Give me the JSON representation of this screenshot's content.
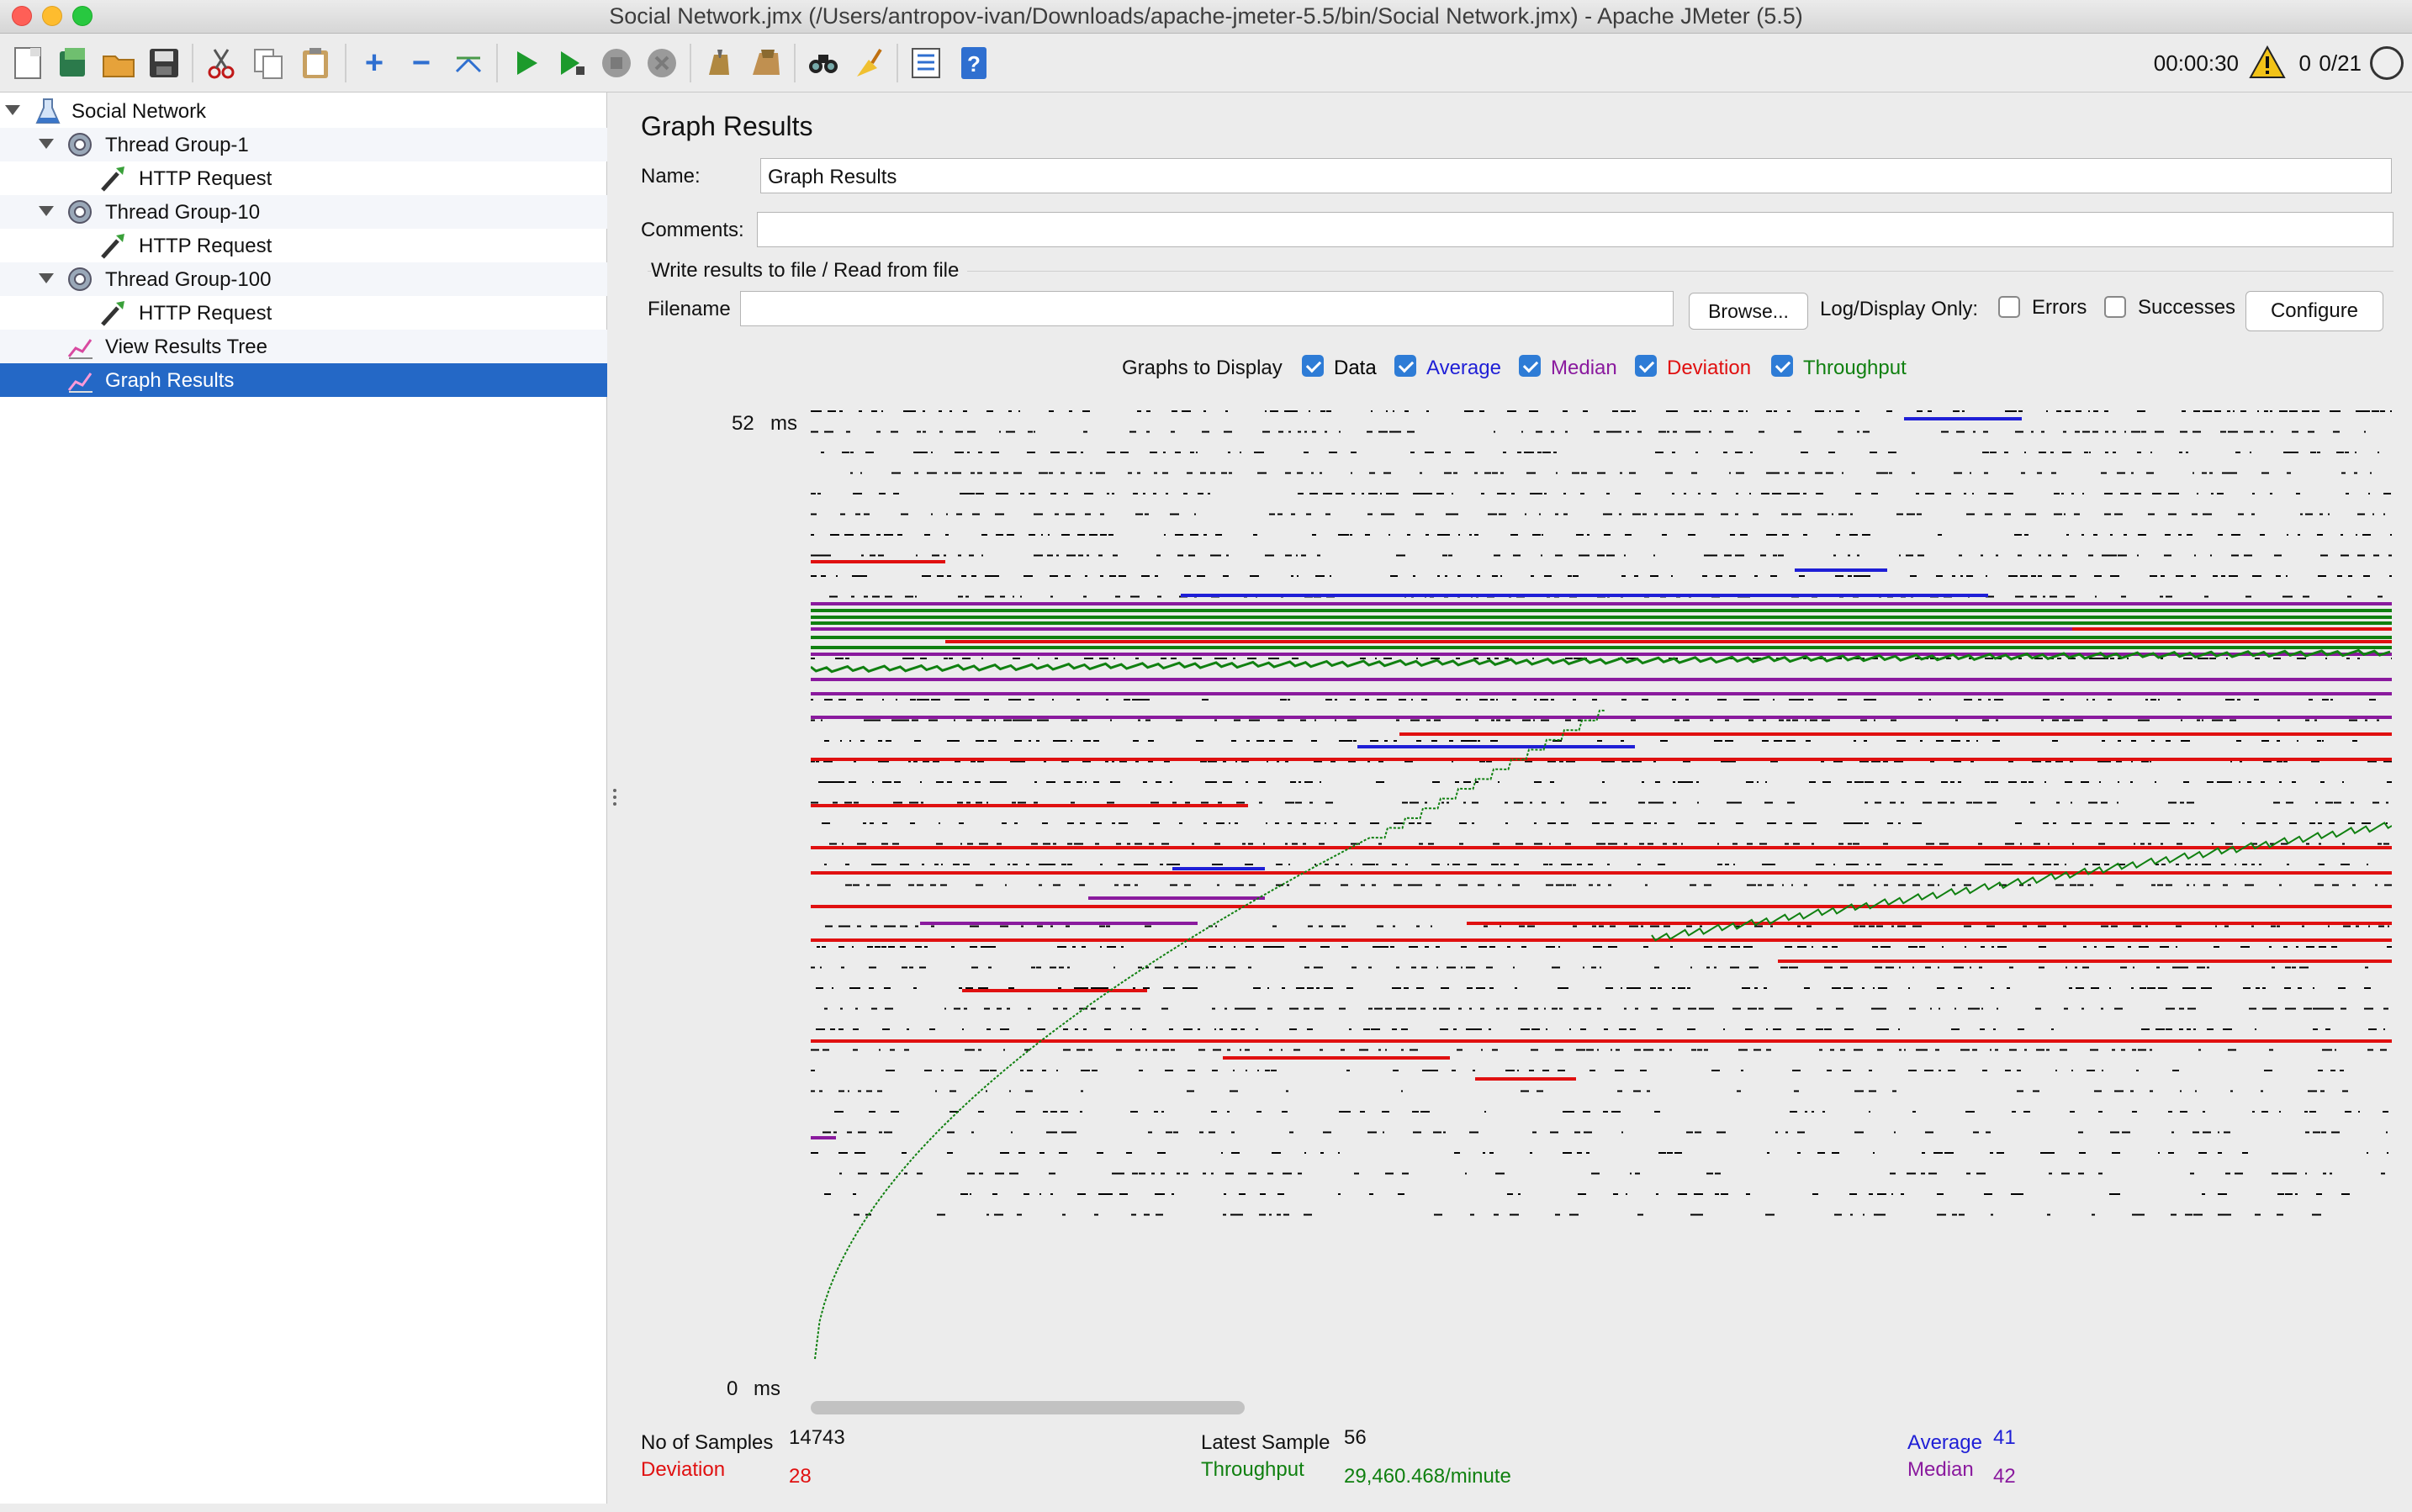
{
  "window": {
    "title": "Social Network.jmx (/Users/antropov-ivan/Downloads/apache-jmeter-5.5/bin/Social Network.jmx) - Apache JMeter (5.5)"
  },
  "toolbar": {
    "buttons": [
      "new-icon",
      "templates-icon",
      "open-icon",
      "save-icon",
      "cut-icon",
      "copy-icon",
      "paste-icon",
      "expand-icon",
      "collapse-icon",
      "toggle-icon",
      "start-icon",
      "start-no-pauses-icon",
      "stop-icon",
      "shutdown-icon",
      "clear-icon",
      "clear-all-icon",
      "search-icon",
      "reset-search-icon",
      "function-helper-icon",
      "help-icon"
    ],
    "timer": "00:00:30",
    "error_count": "0",
    "threads": "0/21"
  },
  "tree": {
    "items": [
      {
        "label": "Social Network",
        "icon": "test-plan-icon"
      },
      {
        "label": "Thread Group-1",
        "icon": "thread-group-icon"
      },
      {
        "label": "HTTP Request",
        "icon": "sampler-icon"
      },
      {
        "label": "Thread Group-10",
        "icon": "thread-group-icon"
      },
      {
        "label": "HTTP Request",
        "icon": "sampler-icon"
      },
      {
        "label": "Thread Group-100",
        "icon": "thread-group-icon"
      },
      {
        "label": "HTTP Request",
        "icon": "sampler-icon"
      },
      {
        "label": "View Results Tree",
        "icon": "listener-icon"
      },
      {
        "label": "Graph Results",
        "icon": "listener-icon"
      }
    ]
  },
  "panel": {
    "heading": "Graph Results",
    "name_label": "Name:",
    "name_value": "Graph Results",
    "comments_label": "Comments:",
    "comments_value": "",
    "file_section": "Write results to file / Read from file",
    "filename_label": "Filename",
    "filename_value": "",
    "browse": "Browse...",
    "log_display_only": "Log/Display Only:",
    "errors": "Errors",
    "successes": "Successes",
    "configure": "Configure",
    "graphs_to_display": "Graphs to Display",
    "toggles": [
      {
        "label": "Data",
        "color": "#000000",
        "checked": true
      },
      {
        "label": "Average",
        "color": "#1f1fd6",
        "checked": true
      },
      {
        "label": "Median",
        "color": "#8a1a9e",
        "checked": true
      },
      {
        "label": "Deviation",
        "color": "#e01010",
        "checked": true
      },
      {
        "label": "Throughput",
        "color": "#108010",
        "checked": true
      }
    ]
  },
  "chart_data": {
    "type": "scatter",
    "y_top_label": "52",
    "y_top_unit": "ms",
    "y_bottom_label": "0",
    "y_bottom_unit": "ms",
    "ylim": [
      0,
      52
    ],
    "series": [
      {
        "name": "Data",
        "color": "#000000"
      },
      {
        "name": "Average",
        "color": "#1f1fd6"
      },
      {
        "name": "Median",
        "color": "#8a1a9e"
      },
      {
        "name": "Deviation",
        "color": "#e01010"
      },
      {
        "name": "Throughput",
        "color": "#108010"
      }
    ]
  },
  "stats": {
    "samples_label": "No of Samples",
    "samples_value": "14743",
    "deviation_label": "Deviation",
    "deviation_value": "28",
    "latest_label": "Latest Sample",
    "latest_value": "56",
    "throughput_label": "Throughput",
    "throughput_value": "29,460.468/minute",
    "average_label": "Average",
    "average_value": "41",
    "median_label": "Median",
    "median_value": "42"
  }
}
